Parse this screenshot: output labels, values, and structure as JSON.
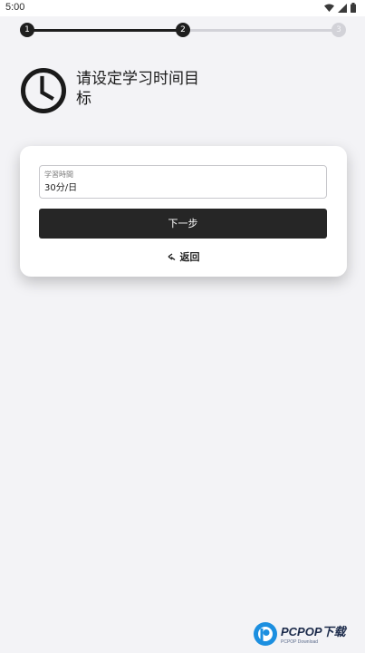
{
  "status_bar": {
    "time": "5:00",
    "icons": [
      "wifi-icon",
      "signal-icon",
      "battery-icon"
    ]
  },
  "stepper": {
    "steps": [
      {
        "label": "1",
        "state": "active"
      },
      {
        "label": "2",
        "state": "active"
      },
      {
        "label": "3",
        "state": "inactive"
      }
    ],
    "colors": {
      "active": "#1e1e1e",
      "inactive": "#d2d2d8"
    }
  },
  "header": {
    "icon": "clock-icon",
    "title": "请设定学习时间目标"
  },
  "form": {
    "field_label": "学習時間",
    "field_value": "30分/日",
    "next_label": "下一步",
    "back_icon": "back-arrow-icon",
    "back_label": "返回"
  },
  "watermark": {
    "logo": "pcpop-logo",
    "text": "PCPOP下载",
    "subtext": "PCPOP Download"
  },
  "colors": {
    "background": "#f3f3f6",
    "card": "#ffffff",
    "button": "#262626"
  }
}
